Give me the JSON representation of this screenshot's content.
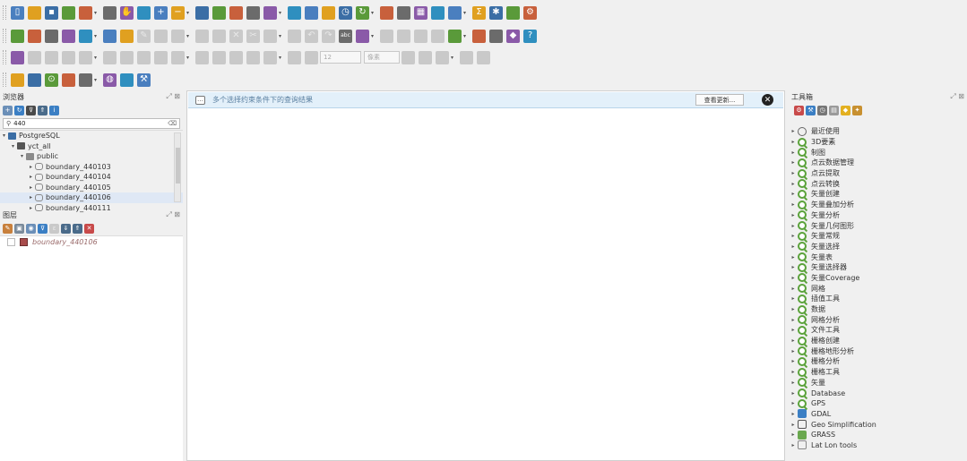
{
  "colors": {
    "accent": "#3a7bd5",
    "qgis_green": "#5aa23a",
    "layer_fill": "#a84c4c",
    "msgbar_bg": "#e3f0fa"
  },
  "toolbar_rows": [
    {
      "icons": [
        "new-project-icon",
        "open-project-icon",
        "save-project-icon",
        "save-as-icon",
        "print-layout-icon",
        "style-manager-icon",
        "pan-icon",
        "pan-to-selection-icon",
        "zoom-in-icon",
        "zoom-out-icon",
        "zoom-full-icon",
        "zoom-selection-icon",
        "zoom-layer-icon",
        "zoom-native-icon",
        "zoom-last-icon",
        "zoom-next-icon",
        "new-bookmark-icon",
        "show-bookmarks-icon",
        "temporal-icon",
        "refresh-icon",
        "select-features-icon",
        "attribute-table-icon",
        "statistics-icon",
        "measure-icon",
        "field-calculator-icon",
        "sum-icon",
        "toolbox-icon",
        "tips-icon",
        "settings-icon"
      ]
    },
    {
      "icons": [
        "add-postgis-icon",
        "add-wms-icon",
        "add-vector-icon",
        "add-delimited-icon",
        "add-spatialite-icon",
        "add-mesh-icon",
        "add-virtual-icon",
        "edit-pencil-icon",
        "toggle-edit-icon",
        "digitize-icon",
        "vertex-icon",
        "save-edits-icon",
        "delete-icon",
        "cut-icon",
        "copy-icon",
        "paste-icon",
        "undo-icon",
        "redo-icon",
        "label-icon",
        "highlight-icon",
        "label-pin-icon",
        "label-move-icon",
        "label-rotate-icon",
        "label-change-icon",
        "db-manager-icon",
        "metasearch-icon",
        "plugins-icon",
        "python-icon",
        "help-icon"
      ]
    },
    {
      "icons": [
        "shape-digitize-icon",
        "curve-icon",
        "circle-icon",
        "rectangle-icon",
        "ellipse-icon",
        "polygon-icon",
        "offset-icon",
        "split-icon",
        "merge-icon",
        "reshape-icon",
        "rotate-icon",
        "simplify-icon",
        "ring-icon",
        "fill-ring-icon",
        "snap-icon",
        "magnet-icon",
        "tracing-icon",
        "tolerance-icon",
        "units-icon",
        "feature-icon",
        "node-icon",
        "topology-icon"
      ],
      "tolerance": "12",
      "units": "像素"
    },
    {
      "icons": [
        "georeference-icon",
        "gps-icon",
        "identify-icon",
        "locate-icon",
        "raster-calc-icon",
        "globe-icon",
        "network-icon",
        "wrench-icon"
      ]
    }
  ],
  "left_panel": {
    "browser_title": "浏览器",
    "browser_float": "⤢ ⊠",
    "browser_search": "440",
    "tree": [
      {
        "label": "PostgreSQL",
        "level": 0,
        "arrow": "▾"
      },
      {
        "label": "yct_all",
        "level": 1,
        "arrow": "▾"
      },
      {
        "label": "public",
        "level": 2,
        "arrow": "▾"
      },
      {
        "label": "boundary_440103",
        "level": 3,
        "arrow": "▸"
      },
      {
        "label": "boundary_440104",
        "level": 3,
        "arrow": "▸"
      },
      {
        "label": "boundary_440105",
        "level": 3,
        "arrow": "▸"
      },
      {
        "label": "boundary_440106",
        "level": 3,
        "arrow": "▸",
        "selected": true
      },
      {
        "label": "boundary_440111",
        "level": 3,
        "arrow": "▸"
      }
    ],
    "layers_title": "图层",
    "layers_float": "⤢ ⊠",
    "layers": [
      {
        "label": "boundary_440106"
      }
    ]
  },
  "canvas": {
    "message": "多个选择约束条件下的查询结果",
    "message_button": "查看更新...",
    "close": "✕"
  },
  "right_panel": {
    "title": "工具箱",
    "float": "⤢ ⊠",
    "tools": [
      {
        "label": "最近使用",
        "icon": "clock"
      },
      {
        "label": "3D要素",
        "icon": "q"
      },
      {
        "label": "制图",
        "icon": "q"
      },
      {
        "label": "点云数据管理",
        "icon": "q"
      },
      {
        "label": "点云提取",
        "icon": "q"
      },
      {
        "label": "点云转换",
        "icon": "q"
      },
      {
        "label": "矢量创建",
        "icon": "q"
      },
      {
        "label": "矢量叠加分析",
        "icon": "q"
      },
      {
        "label": "矢量分析",
        "icon": "q"
      },
      {
        "label": "矢量几何图形",
        "icon": "q"
      },
      {
        "label": "矢量常规",
        "icon": "q"
      },
      {
        "label": "矢量选择",
        "icon": "q"
      },
      {
        "label": "矢量表",
        "icon": "q"
      },
      {
        "label": "矢量选择器",
        "icon": "q"
      },
      {
        "label": "矢量Coverage",
        "icon": "q"
      },
      {
        "label": "网格",
        "icon": "q"
      },
      {
        "label": "插值工具",
        "icon": "q"
      },
      {
        "label": "数据",
        "icon": "q"
      },
      {
        "label": "网格分析",
        "icon": "q"
      },
      {
        "label": "文件工具",
        "icon": "q"
      },
      {
        "label": "栅格创建",
        "icon": "q"
      },
      {
        "label": "栅格地形分析",
        "icon": "q"
      },
      {
        "label": "栅格分析",
        "icon": "q"
      },
      {
        "label": "栅格工具",
        "icon": "q"
      },
      {
        "label": "矢量",
        "icon": "q"
      },
      {
        "label": "Database",
        "icon": "q"
      },
      {
        "label": "GPS",
        "icon": "q"
      },
      {
        "label": "GDAL",
        "icon": "gdal"
      },
      {
        "label": "Geo Simplification",
        "icon": "geo"
      },
      {
        "label": "GRASS",
        "icon": "grass"
      },
      {
        "label": "Lat Lon tools",
        "icon": "latlon"
      }
    ]
  }
}
